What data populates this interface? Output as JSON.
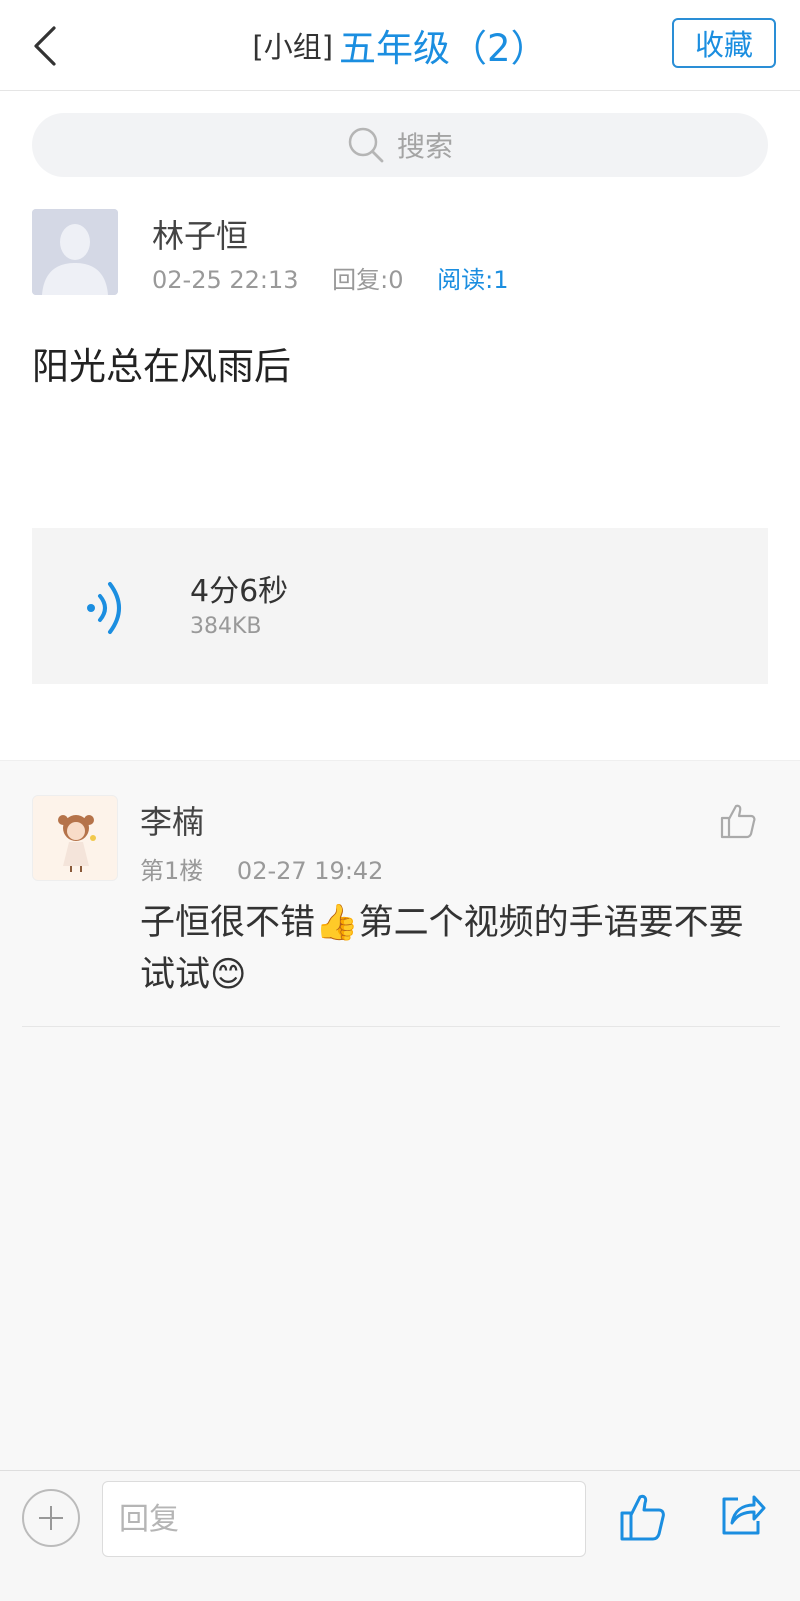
{
  "header": {
    "group_prefix": "[小组]",
    "group_name": "五年级（2）",
    "favorite_label": "收藏"
  },
  "search": {
    "placeholder": "搜索"
  },
  "post": {
    "author": "林子恒",
    "datetime": "02-25 22:13",
    "replies": "回复:0",
    "reads": "阅读:1",
    "content": "阳光总在风雨后",
    "audio": {
      "duration": "4分6秒",
      "size": "384KB"
    }
  },
  "comments": [
    {
      "author": "李楠",
      "floor": "第1楼",
      "datetime": "02-27 19:42",
      "text": "子恒很不错👍第二个视频的手语要不要试试😊"
    }
  ],
  "bottom_bar": {
    "reply_placeholder": "回复"
  },
  "colors": {
    "accent": "#1b8ee0",
    "muted": "#999999"
  },
  "icons": [
    "back-icon",
    "search-icon",
    "voice-icon",
    "thumbs-up-icon",
    "plus-icon",
    "share-icon",
    "avatar-placeholder-icon"
  ]
}
